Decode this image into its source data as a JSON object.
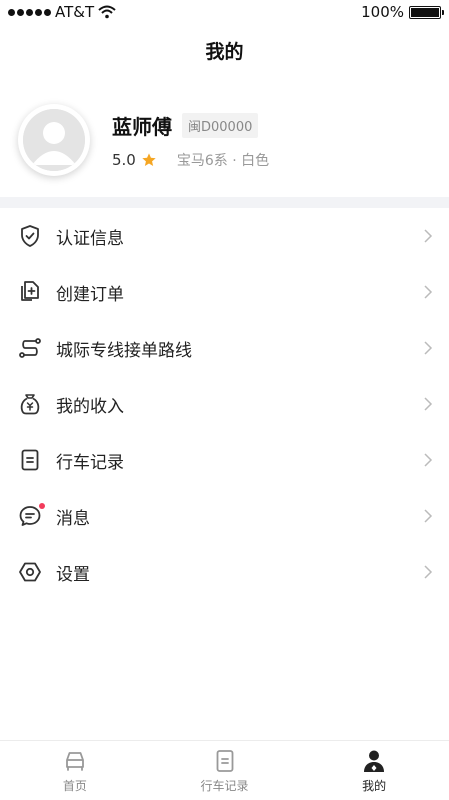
{
  "status_bar": {
    "carrier": "AT&T",
    "battery": "100%",
    "battery_level": 1.0
  },
  "header": {
    "title": "我的"
  },
  "profile": {
    "name": "蓝师傅",
    "plate": "闽D00000",
    "rating": "5.0",
    "car": "宝马6系 · 白色"
  },
  "menu": {
    "items": [
      {
        "label": "认证信息",
        "icon": "shield-check-icon"
      },
      {
        "label": "创建订单",
        "icon": "document-add-icon"
      },
      {
        "label": "城际专线接单路线",
        "icon": "route-icon"
      },
      {
        "label": "我的收入",
        "icon": "money-bag-icon"
      },
      {
        "label": "行车记录",
        "icon": "record-icon"
      },
      {
        "label": "消息",
        "icon": "message-icon",
        "has_unread_dot": true
      },
      {
        "label": "设置",
        "icon": "settings-icon"
      }
    ]
  },
  "tab_bar": {
    "tabs": [
      {
        "label": "首页",
        "icon": "car-icon",
        "active": false
      },
      {
        "label": "行车记录",
        "icon": "record-icon",
        "active": false
      },
      {
        "label": "我的",
        "icon": "user-icon",
        "active": true
      }
    ]
  },
  "colors": {
    "star": "#f5a623",
    "unread_dot": "#f23b5b",
    "section_band": "#f2f3f6"
  }
}
